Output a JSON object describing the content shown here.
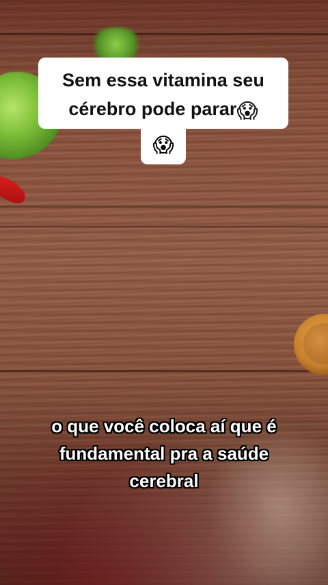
{
  "top_caption": {
    "line1": "Sem essa vitamina seu",
    "line2": "cérebro pode parar",
    "emoji": "😱",
    "emoji2": "😱"
  },
  "subtitle": {
    "line1": "o que você coloca aí que é",
    "line2": "fundamental pra a saúde",
    "line3": "cerebral"
  },
  "colors": {
    "caption_bg": "#ffffff",
    "caption_text": "#111111",
    "subtitle_text": "#ffffff",
    "subtitle_outline": "#000000"
  }
}
